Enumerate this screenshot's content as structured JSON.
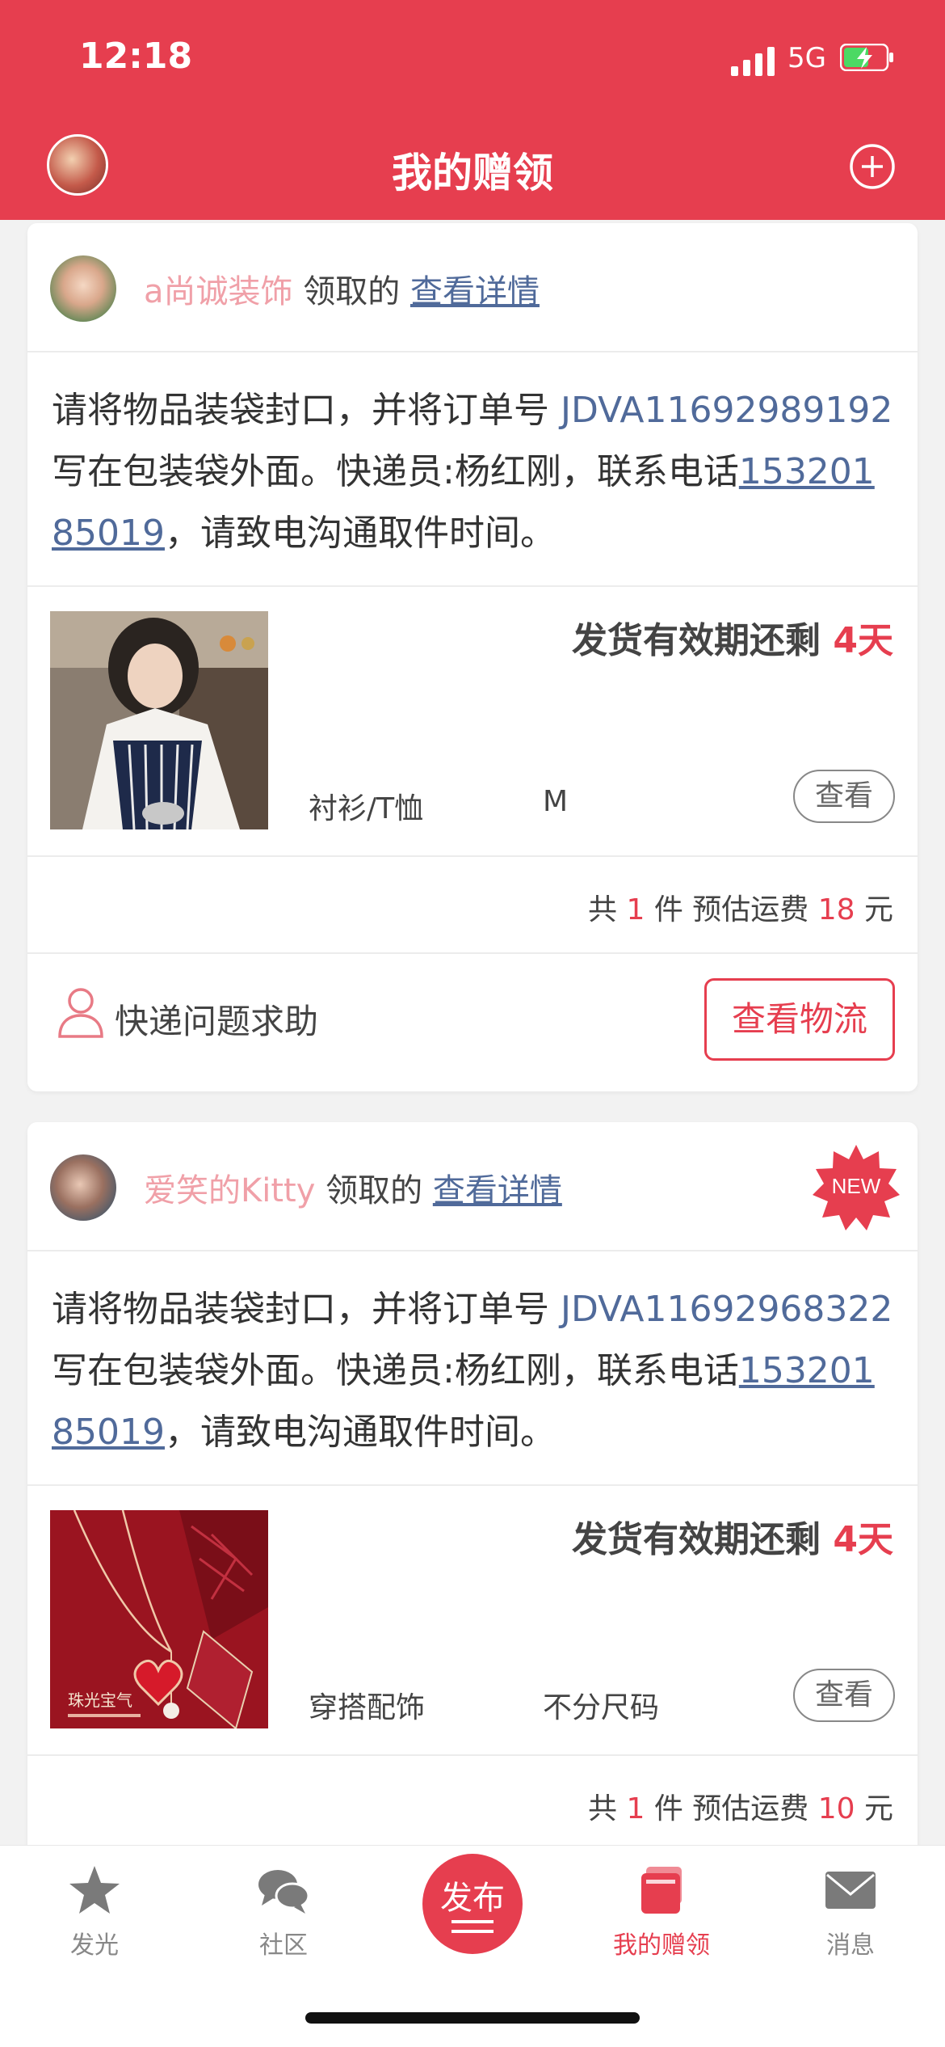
{
  "status": {
    "time": "12:18",
    "network": "5G"
  },
  "nav": {
    "title": "我的赠领"
  },
  "cards": [
    {
      "username": "a尚诚装饰",
      "verb": "领取的",
      "detail_link": "查看详情",
      "message": {
        "prefix": "请将物品装袋封口，并将订单号 ",
        "order_no": "JDVA11692989192",
        "middle": " 写在包装袋外面。快递员:杨红刚，联系电话",
        "phone": "15320185019",
        "suffix": "，请致电沟通取件时间。"
      },
      "expiry_label": "发货有效期还剩 ",
      "expiry_days": "4天",
      "category": "衬衫/T恤",
      "size": "M",
      "view_label": "查看",
      "summary": {
        "pre": "共 ",
        "count": "1",
        "mid": " 件 预估运费 ",
        "fee": "18",
        "unit": " 元"
      },
      "help_label": "快递问题求助",
      "track_label": "查看物流"
    },
    {
      "username": "爱笑的Kitty",
      "verb": "领取的",
      "detail_link": "查看详情",
      "badge": "NEW",
      "message": {
        "prefix": "请将物品装袋封口，并将订单号 ",
        "order_no": "JDVA11692968322",
        "middle": " 写在包装袋外面。快递员:杨红刚，联系电话",
        "phone": "15320185019",
        "suffix": "，请致电沟通取件时间。"
      },
      "expiry_label": "发货有效期还剩 ",
      "expiry_days": "4天",
      "category": "穿搭配饰",
      "size": "不分尺码",
      "view_label": "查看",
      "image_text": "珠光宝气",
      "summary": {
        "pre": "共 ",
        "count": "1",
        "mid": " 件 预估运费 ",
        "fee": "10",
        "unit": " 元"
      }
    }
  ],
  "tabs": [
    {
      "label": "发光",
      "icon": "star-icon"
    },
    {
      "label": "社区",
      "icon": "chat-bubbles-icon"
    },
    {
      "label": "发布",
      "icon": "publish-icon"
    },
    {
      "label": "我的赠领",
      "icon": "gift-cards-icon"
    },
    {
      "label": "消息",
      "icon": "mail-icon"
    }
  ],
  "colors": {
    "brand": "#e63e4f",
    "link": "#506a9a",
    "username": "#f0a0a8"
  }
}
